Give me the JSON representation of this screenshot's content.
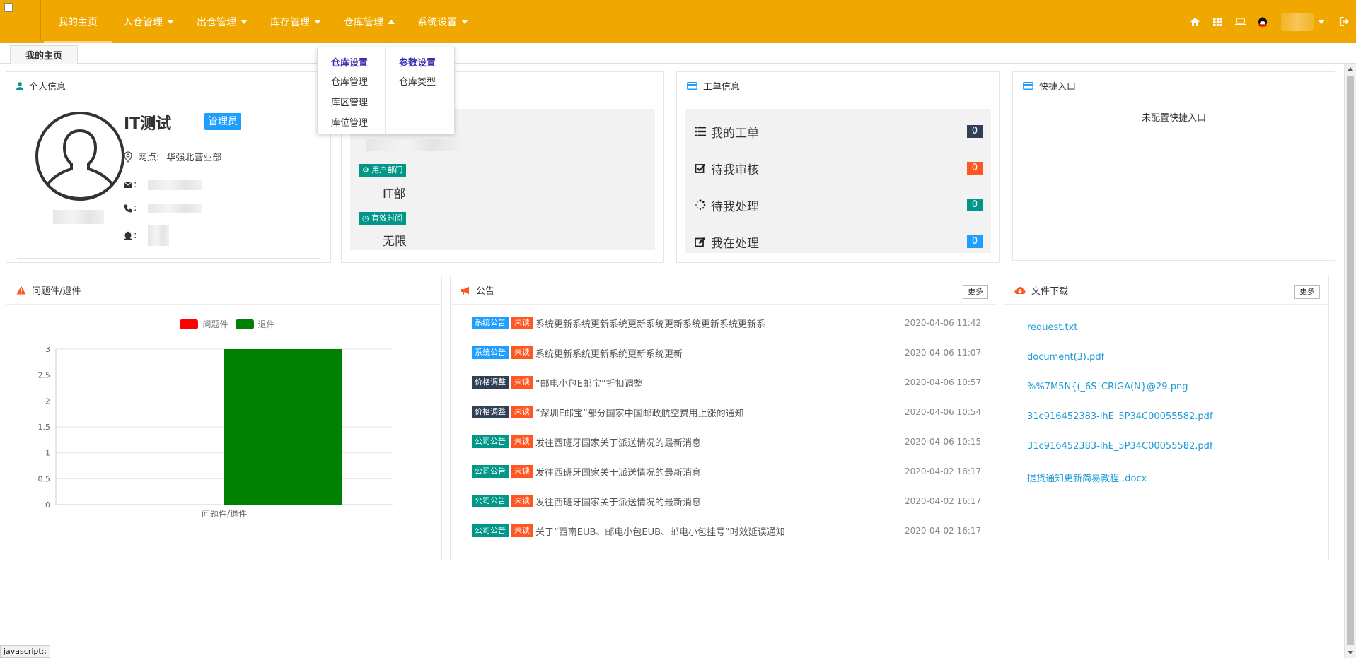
{
  "nav": {
    "home": "我的主页",
    "items": [
      "入仓管理",
      "出仓管理",
      "库存管理",
      "仓库管理",
      "系统设置"
    ]
  },
  "tab": {
    "label": "我的主页"
  },
  "dropdown": {
    "col1": {
      "title": "仓库设置",
      "items": [
        "仓库管理",
        "库区管理",
        "库位管理"
      ]
    },
    "col2": {
      "title": "参数设置",
      "items": [
        "仓库类型"
      ]
    }
  },
  "personal": {
    "title": "个人信息",
    "name": "IT测试",
    "role": "管理员",
    "site_label": "网点:",
    "site_value": "华强北营业部",
    "email_label": ":",
    "phone_label": ":",
    "qq_label": ":"
  },
  "dept": {
    "dept_label": "用户部门",
    "dept_value": "IT部",
    "valid_label": "有效时间",
    "valid_value": "无限"
  },
  "tickets": {
    "title": "工单信息",
    "rows": [
      {
        "label": "我的工单",
        "count": "0",
        "color": "#2f4056"
      },
      {
        "label": "待我审核",
        "count": "0",
        "color": "#ff5722"
      },
      {
        "label": "待我处理",
        "count": "0",
        "color": "#009688"
      },
      {
        "label": "我在处理",
        "count": "0",
        "color": "#1e9fff"
      }
    ]
  },
  "quick": {
    "title": "快捷入口",
    "empty": "未配置快捷入口"
  },
  "issues": {
    "title": "问题件/退件"
  },
  "chart_data": {
    "type": "bar",
    "categories": [
      "问题件/退件"
    ],
    "series": [
      {
        "name": "问题件",
        "values": [
          0
        ],
        "color": "#ff0000"
      },
      {
        "name": "退件",
        "values": [
          3
        ],
        "color": "#008000"
      }
    ],
    "ylim": [
      0,
      3
    ],
    "yticks": [
      "0",
      "0.5",
      "1",
      "1.5",
      "2",
      "2.5",
      "3"
    ],
    "legend": "top",
    "grid": true
  },
  "notices": {
    "title": "公告",
    "more": "更多",
    "unread": "未读",
    "items": [
      {
        "tag": "系统公告",
        "tag_color": "#1e9fff",
        "title": "系统更新系统更新系统更新系统更新系统更新系统更新系",
        "time": "2020-04-06 11:42"
      },
      {
        "tag": "系统公告",
        "tag_color": "#1e9fff",
        "title": "系统更新系统更新系统更新系统更新",
        "time": "2020-04-06 11:07"
      },
      {
        "tag": "价格调整",
        "tag_color": "#2f4056",
        "title": "“邮电小包E邮宝”折扣调整",
        "time": "2020-04-06 10:57"
      },
      {
        "tag": "价格调整",
        "tag_color": "#2f4056",
        "title": "“深圳E邮宝”部分国家中国邮政航空费用上涨的通知",
        "time": "2020-04-06 10:54"
      },
      {
        "tag": "公司公告",
        "tag_color": "#009688",
        "title": "发往西班牙国家关于派送情况的最新消息",
        "time": "2020-04-06 10:15"
      },
      {
        "tag": "公司公告",
        "tag_color": "#009688",
        "title": "发往西班牙国家关于派送情况的最新消息",
        "time": "2020-04-02 16:17"
      },
      {
        "tag": "公司公告",
        "tag_color": "#009688",
        "title": "发往西班牙国家关于派送情况的最新消息",
        "time": "2020-04-02 16:17"
      },
      {
        "tag": "公司公告",
        "tag_color": "#009688",
        "title": "关于“西南EUB、邮电小包EUB、邮电小包挂号”时效延误通知",
        "time": "2020-04-02 16:17"
      }
    ]
  },
  "files": {
    "title": "文件下载",
    "more": "更多",
    "items": [
      "request.txt",
      "document(3).pdf",
      "%%7M5N{(_6S`CRIGA(N}@29.png",
      "31c916452383-lhE_5P34C00055582.pdf",
      "31c916452383-lhE_5P34C00055582.pdf",
      "提货通知更新简易教程 .docx"
    ]
  },
  "status_bar": "javascript:;",
  "colors": {
    "topbar": "#f0a800",
    "accent": "#1e9fff",
    "link": "#1c9bd6"
  }
}
